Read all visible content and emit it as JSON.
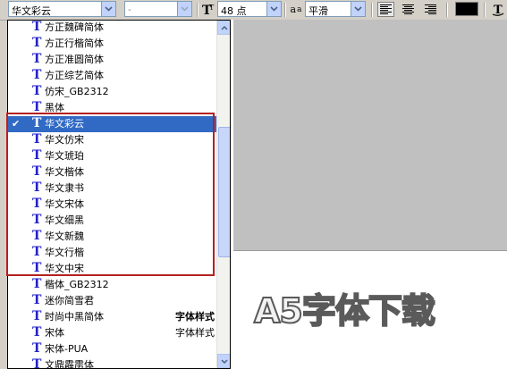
{
  "toolbar": {
    "font_family_value": "华文彩云",
    "font_style_value": "-",
    "font_size_icon": "font-size-icon",
    "font_size_value": "48 点",
    "antialias_icon": "antialias-icon",
    "antialias_glyph": "a",
    "antialias_glyph_small": "a",
    "antialias_value": "平滑",
    "align_buttons": [
      "align-left-icon",
      "align-center-icon",
      "align-right-icon"
    ],
    "text_color": "#000000"
  },
  "font_list": {
    "items": [
      {
        "name": "方正魏碑简体",
        "sample": "",
        "checked": false,
        "selected": false
      },
      {
        "name": "方正行楷简体",
        "sample": "",
        "checked": false,
        "selected": false
      },
      {
        "name": "方正准圆简体",
        "sample": "",
        "checked": false,
        "selected": false
      },
      {
        "name": "方正综艺简体",
        "sample": "",
        "checked": false,
        "selected": false
      },
      {
        "name": "仿宋_GB2312",
        "sample": "",
        "checked": false,
        "selected": false
      },
      {
        "name": "黑体",
        "sample": "",
        "checked": false,
        "selected": false
      },
      {
        "name": "华文彩云",
        "sample": "",
        "checked": true,
        "selected": true
      },
      {
        "name": "华文仿宋",
        "sample": "",
        "checked": false,
        "selected": false
      },
      {
        "name": "华文琥珀",
        "sample": "",
        "checked": false,
        "selected": false
      },
      {
        "name": "华文楷体",
        "sample": "",
        "checked": false,
        "selected": false
      },
      {
        "name": "华文隶书",
        "sample": "",
        "checked": false,
        "selected": false
      },
      {
        "name": "华文宋体",
        "sample": "",
        "checked": false,
        "selected": false
      },
      {
        "name": "华文细黑",
        "sample": "",
        "checked": false,
        "selected": false
      },
      {
        "name": "华文新魏",
        "sample": "",
        "checked": false,
        "selected": false
      },
      {
        "name": "华文行楷",
        "sample": "",
        "checked": false,
        "selected": false
      },
      {
        "name": "华文中宋",
        "sample": "",
        "checked": false,
        "selected": false
      },
      {
        "name": "楷体_GB2312",
        "sample": "",
        "checked": false,
        "selected": false
      },
      {
        "name": "迷你简雪君",
        "sample": "",
        "checked": false,
        "selected": false
      },
      {
        "name": "时尚中黑简体",
        "sample": "字体样式",
        "checked": false,
        "selected": false
      },
      {
        "name": "宋体",
        "sample": "字体样式",
        "checked": false,
        "selected": false
      },
      {
        "name": "宋体-PUA",
        "sample": "",
        "checked": false,
        "selected": false
      },
      {
        "name": "文鼎霹雳体",
        "sample": "",
        "checked": false,
        "selected": false
      }
    ],
    "check_glyph": "✔",
    "type_glyph": "T",
    "highlight_color": "#b52020"
  },
  "canvas": {
    "preview_text": "A5字体下载"
  }
}
